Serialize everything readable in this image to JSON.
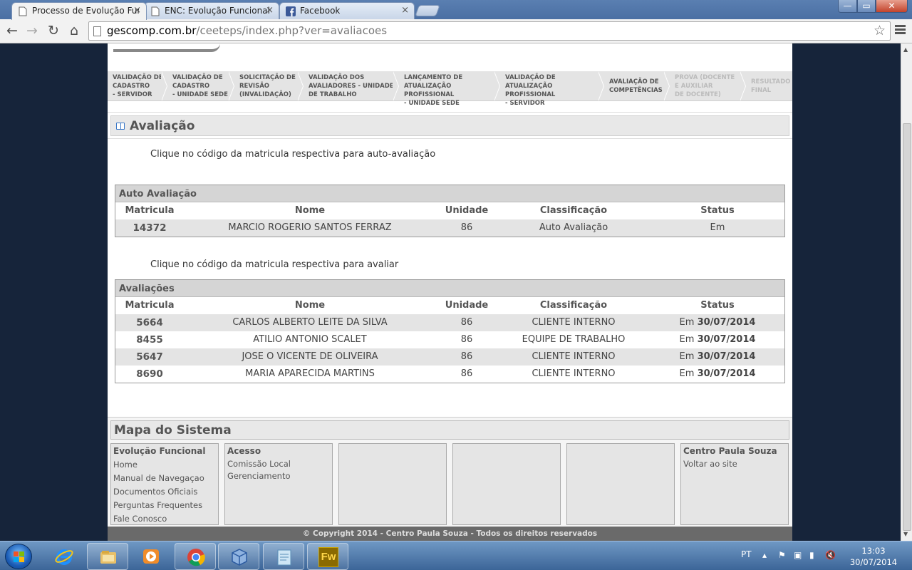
{
  "browser": {
    "tabs": [
      {
        "label": "Processo de Evolução Fun",
        "icon": "page-icon",
        "active": true
      },
      {
        "label": "ENC: Evolução Funcional",
        "icon": "page-icon",
        "active": false
      },
      {
        "label": "Facebook",
        "icon": "facebook-icon",
        "active": false
      }
    ],
    "tab_close": "×",
    "window_controls": {
      "minimize": "—",
      "maximize": "▭",
      "close": "✕"
    },
    "nav": {
      "back": "←",
      "forward": "→",
      "reload": "↻",
      "home": "⌂"
    },
    "url_host": "gescomp.com.br",
    "url_path": "/ceeteps/index.php?ver=avaliacoes",
    "bookmark_star": "☆"
  },
  "steps": [
    {
      "label": "Validação de cadastro - servidor",
      "lines": [
        "VALIDAÇÃO DE",
        "CADASTRO",
        "- SERVIDOR"
      ],
      "enabled": true
    },
    {
      "label": "Validação de cadastro - unidade sede",
      "lines": [
        "VALIDAÇÃO DE",
        "CADASTRO",
        "- UNIDADE SEDE"
      ],
      "enabled": true
    },
    {
      "label": "Solicitação de revisão (invalidação)",
      "lines": [
        "SOLICITAÇÃO DE",
        "REVISÃO",
        "(INVALIDAÇÃO)"
      ],
      "enabled": true
    },
    {
      "label": "Validação dos avaliadores - unidade de trabalho",
      "lines": [
        "VALIDAÇÃO DOS",
        "AVALIADORES - UNIDADE",
        "DE TRABALHO"
      ],
      "enabled": true
    },
    {
      "label": "Lançamento de atualização profissional - unidade sede",
      "lines": [
        "LANÇAMENTO DE",
        "ATUALIZAÇÃO PROFISSIONAL",
        "- UNIDADE SEDE"
      ],
      "enabled": true
    },
    {
      "label": "Validação de atualização profissional - servidor",
      "lines": [
        "VALIDAÇÃO DE",
        "ATUALIZAÇÃO PROFISSIONAL",
        "- SERVIDOR"
      ],
      "enabled": true
    },
    {
      "label": "Avaliação de competências",
      "lines": [
        "AVALIAÇÃO DE",
        "COMPETÊNCIAS"
      ],
      "enabled": true
    },
    {
      "label": "Prova (docente e auxiliar de docente)",
      "lines": [
        "PROVA (DOCENTE",
        "E AUXILIAR",
        "DE DOCENTE)"
      ],
      "enabled": false
    },
    {
      "label": "Resultado final",
      "lines": [
        "RESULTADO",
        "FINAL"
      ],
      "enabled": false
    }
  ],
  "section_title": "Avaliação",
  "auto": {
    "hint": "Clique no código da matricula respectiva para auto-avaliação",
    "caption": "Auto Avaliação",
    "headers": {
      "matricula": "Matricula",
      "nome": "Nome",
      "unidade": "Unidade",
      "classificacao": "Classificação",
      "status": "Status"
    },
    "rows": [
      {
        "matricula": "14372",
        "nome": "MARCIO ROGERIO SANTOS FERRAZ",
        "unidade": "86",
        "classificacao": "Auto Avaliação",
        "status": "Em",
        "date": ""
      }
    ]
  },
  "avaliacoes": {
    "hint": "Clique no código da matricula respectiva para avaliar",
    "caption": "Avaliações",
    "headers": {
      "matricula": "Matricula",
      "nome": "Nome",
      "unidade": "Unidade",
      "classificacao": "Classificação",
      "status": "Status"
    },
    "rows": [
      {
        "matricula": "5664",
        "nome": "CARLOS ALBERTO LEITE DA SILVA",
        "unidade": "86",
        "classificacao": "CLIENTE INTERNO",
        "status": "Em",
        "date": "30/07/2014"
      },
      {
        "matricula": "8455",
        "nome": "ATILIO ANTONIO SCALET",
        "unidade": "86",
        "classificacao": "EQUIPE DE TRABALHO",
        "status": "Em",
        "date": "30/07/2014"
      },
      {
        "matricula": "5647",
        "nome": "JOSE O VICENTE DE OLIVEIRA",
        "unidade": "86",
        "classificacao": "CLIENTE INTERNO",
        "status": "Em",
        "date": "30/07/2014"
      },
      {
        "matricula": "8690",
        "nome": "MARIA APARECIDA MARTINS",
        "unidade": "86",
        "classificacao": "CLIENTE INTERNO",
        "status": "Em",
        "date": "30/07/2014"
      }
    ]
  },
  "mapa": {
    "title": "Mapa do Sistema",
    "columns": [
      {
        "heading": "Evolução Funcional",
        "links": [
          "Home",
          "Manual de Navegaçao",
          "Documentos Oficiais",
          "Perguntas Frequentes",
          "Fale Conosco"
        ]
      },
      {
        "heading": "Acesso",
        "links": [
          "Comissão Local",
          "Gerenciamento"
        ]
      },
      {
        "heading": "",
        "links": []
      },
      {
        "heading": "",
        "links": []
      },
      {
        "heading": "",
        "links": []
      },
      {
        "heading": "Centro Paula Souza",
        "links": [
          "Voltar ao site"
        ]
      }
    ]
  },
  "footer": "© Copyright 2014 - Centro Paula Souza - Todos os direitos reservados",
  "taskbar": {
    "pinned": [
      "internet-explorer-icon",
      "file-explorer-icon",
      "media-player-icon",
      "chrome-icon",
      "virtualbox-icon",
      "notepad-icon",
      "fireworks-icon"
    ],
    "fireworks_label": "Fw",
    "language": "PT",
    "time": "13:03",
    "date": "30/07/2014"
  },
  "colors": {
    "accent_blue": "#3a78c8",
    "table_header": "#d5d5d5",
    "alt_row": "#e4e4e4"
  }
}
